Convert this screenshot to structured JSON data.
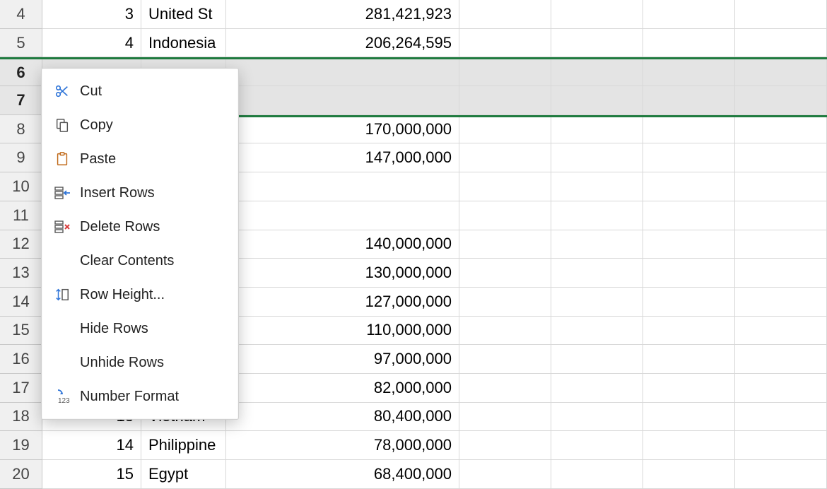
{
  "rows": [
    {
      "num": "4",
      "a": "3",
      "b": "United St",
      "c": "281,421,923"
    },
    {
      "num": "5",
      "a": "4",
      "b": "Indonesia",
      "c": "206,264,595"
    },
    {
      "num": "6",
      "a": "",
      "b": "",
      "c": "",
      "selected": true,
      "selTop": true
    },
    {
      "num": "7",
      "a": "",
      "b": "",
      "c": "",
      "selected": true,
      "selBot": true
    },
    {
      "num": "8",
      "a": "",
      "b": "",
      "c": "170,000,000"
    },
    {
      "num": "9",
      "a": "",
      "b": "",
      "c": "147,000,000"
    },
    {
      "num": "10",
      "a": "",
      "b": "",
      "c": ""
    },
    {
      "num": "11",
      "a": "",
      "b": "",
      "c": ""
    },
    {
      "num": "12",
      "a": "",
      "b": "",
      "c": "140,000,000"
    },
    {
      "num": "13",
      "a": "",
      "b": "",
      "c": "130,000,000"
    },
    {
      "num": "14",
      "a": "",
      "b": "",
      "c": "127,000,000"
    },
    {
      "num": "15",
      "a": "",
      "b": "",
      "c": "110,000,000"
    },
    {
      "num": "16",
      "a": "",
      "b": "",
      "c": "97,000,000"
    },
    {
      "num": "17",
      "a": "",
      "b": "",
      "c": "82,000,000"
    },
    {
      "num": "18",
      "a": "13",
      "b": "Vietnam",
      "c": "80,400,000"
    },
    {
      "num": "19",
      "a": "14",
      "b": "Philippine",
      "c": "78,000,000"
    },
    {
      "num": "20",
      "a": "15",
      "b": "Egypt",
      "c": "68,400,000"
    }
  ],
  "context_menu": {
    "cut": "Cut",
    "copy": "Copy",
    "paste": "Paste",
    "insert_rows": "Insert Rows",
    "delete_rows": "Delete Rows",
    "clear": "Clear Contents",
    "row_height": "Row Height...",
    "hide": "Hide Rows",
    "unhide": "Unhide Rows",
    "number_format": "Number Format"
  }
}
